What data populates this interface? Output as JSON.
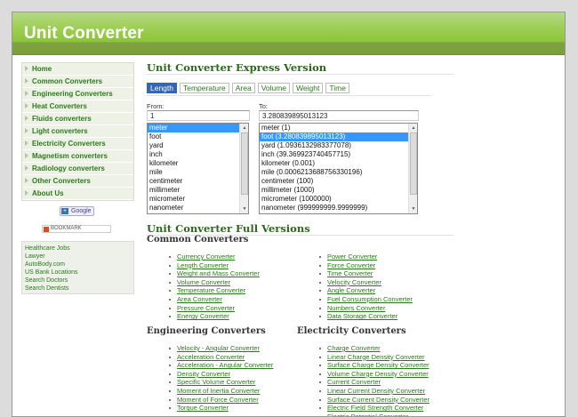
{
  "header": {
    "title": "Unit Converter"
  },
  "menu": [
    "Home",
    "Common Converters",
    "Engineering Converters",
    "Heat Converters",
    "Fluids converters",
    "Light converters",
    "Electricity Converters",
    "Magnetism converters",
    "Radiology converters",
    "Other Converters",
    "About Us"
  ],
  "google_button": "Google",
  "bookmark_button": "BOOKMARK",
  "side_links": [
    "Healthcare Jobs",
    "Lawyer",
    "AutoBody.com",
    "US Bank Locations",
    "Search Doctors",
    "Search Dentists"
  ],
  "express": {
    "title": "Unit Converter Express Version",
    "tabs": [
      "Length",
      "Temperature",
      "Area",
      "Volume",
      "Weight",
      "Time"
    ],
    "from_label": "From:",
    "from_value": "1",
    "to_label": "To:",
    "to_value": "3.280839895013123",
    "from_units": [
      "meter",
      "foot",
      "yard",
      "inch",
      "kilometer",
      "mile",
      "centimeter",
      "millimeter",
      "micrometer",
      "nanometer"
    ],
    "to_units": [
      "meter (1)",
      "foot (3.280839895013123)",
      "yard (1.0936132983377078)",
      "inch (39.369923740457715)",
      "kilometer (0.001)",
      "mile (0.0006213688756330196)",
      "centimeter (100)",
      "millimeter (1000)",
      "micrometer (1000000)",
      "nanometer (999999999.9999999)"
    ]
  },
  "full": {
    "title": "Unit Converter Full Versions",
    "common_heading": "Common Converters",
    "common_left": [
      "Currency Converter",
      "Length Converter",
      "Weight and Mass Converter",
      "Volume Converter",
      "Temperature Converter",
      "Area Converter",
      "Pressure Converter",
      "Energy Converter"
    ],
    "common_right": [
      "Power Converter",
      "Force Converter",
      "Time Converter",
      "Velocity Converter",
      "Angle Converter",
      "Fuel Consumption Converter",
      "Numbers Converter",
      "Data Storage Converter"
    ],
    "engineering_heading": "Engineering Converters",
    "engineering": [
      "Velocity - Angular Converter",
      "Acceleration Converter",
      "Acceleration - Angular Converter",
      "Density Converter",
      "Specific Volume Converter",
      "Moment of Inertia Converter",
      "Moment of Force Converter",
      "Torque Converter"
    ],
    "electricity_heading": "Electricity Converters",
    "electricity": [
      "Charge Converter",
      "Linear Charge Density Converter",
      "Surface Charge Density Converter",
      "Volume Charge Density Converter",
      "Current Converter",
      "Linear Current Density Converter",
      "Surface Current Density Converter",
      "Electric Field Strength Converter",
      "Electric Potential Converter"
    ]
  }
}
